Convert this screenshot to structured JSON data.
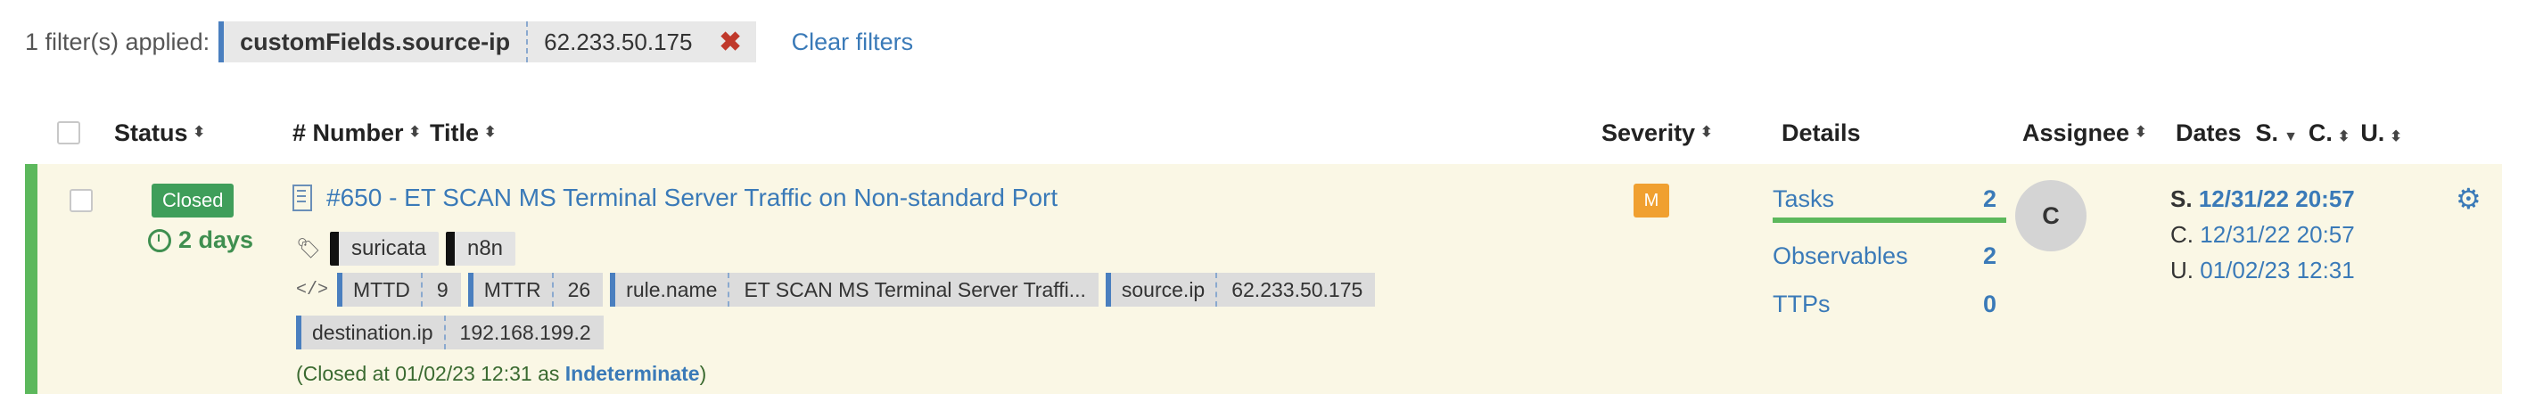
{
  "filters": {
    "summary": "1 filter(s) applied:",
    "chip_key": "customFields.source-ip",
    "chip_value": "62.233.50.175",
    "remove_icon": "close-icon",
    "clear_label": "Clear filters"
  },
  "table": {
    "headers": {
      "status": "Status",
      "number": "# Number",
      "title": "Title",
      "severity": "Severity",
      "details": "Details",
      "assignee": "Assignee",
      "dates": "Dates",
      "dates_s": "S.",
      "dates_c": "C.",
      "dates_u": "U."
    },
    "row": {
      "status": "Closed",
      "age": "2 days",
      "title": "#650 - ET SCAN MS Terminal Server Traffic on Non-standard Port",
      "tags": [
        "suricata",
        "n8n"
      ],
      "fields": [
        {
          "key": "MTTD",
          "value": "9"
        },
        {
          "key": "MTTR",
          "value": "26"
        },
        {
          "key": "rule.name",
          "value": "ET SCAN MS Terminal Server Traffi..."
        },
        {
          "key": "source.ip",
          "value": "62.233.50.175"
        },
        {
          "key": "destination.ip",
          "value": "192.168.199.2"
        }
      ],
      "closed_prefix": "(Closed at 01/02/23 12:31 as ",
      "closed_status": "Indeterminate",
      "closed_suffix": ")",
      "severity": "M",
      "details": {
        "tasks_label": "Tasks",
        "tasks_count": "2",
        "observables_label": "Observables",
        "observables_count": "2",
        "ttps_label": "TTPs",
        "ttps_count": "0",
        "tasks_progress": 1.0
      },
      "assignee_initial": "C",
      "dates": {
        "s_label": "S.",
        "s_value": "12/31/22 20:57",
        "c_label": "C.",
        "c_value": "12/31/22 20:57",
        "u_label": "U.",
        "u_value": "01/02/23 12:31"
      }
    }
  },
  "colors": {
    "accent": "#3a7ab8",
    "closed_green": "#3f9e5a",
    "severity_medium": "#f0a030",
    "row_bg": "#faf7e5"
  }
}
